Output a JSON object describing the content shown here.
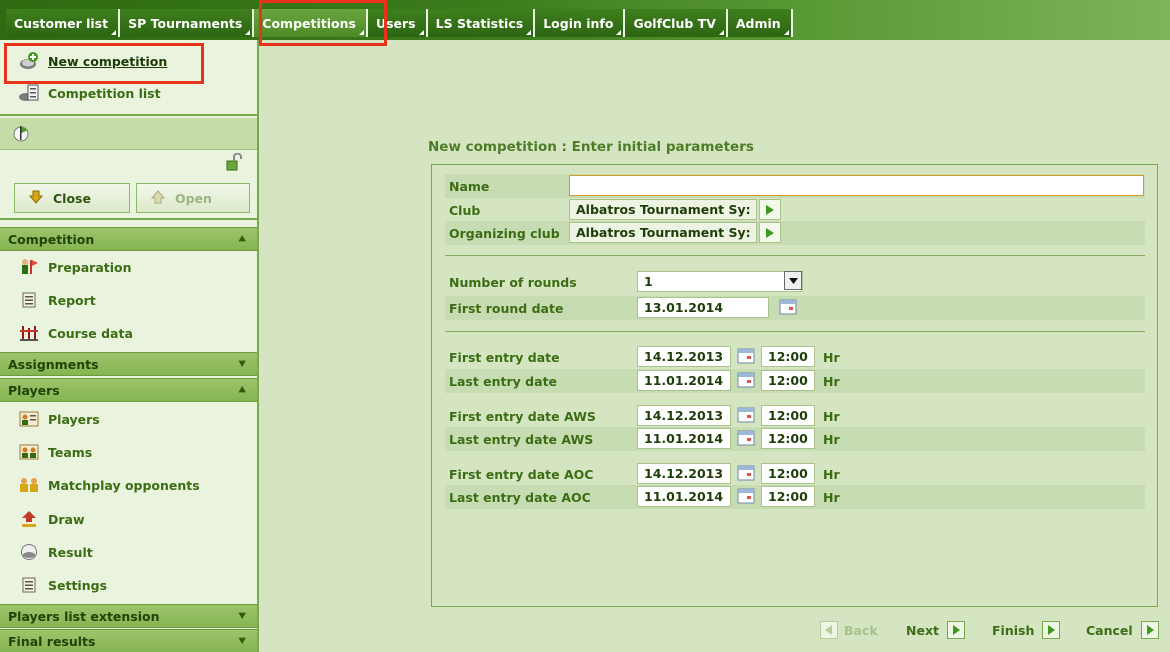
{
  "topnav": {
    "items": [
      {
        "label": "Customer list"
      },
      {
        "label": "SP Tournaments"
      },
      {
        "label": "Competitions"
      },
      {
        "label": "Users"
      },
      {
        "label": "LS Statistics"
      },
      {
        "label": "Login info"
      },
      {
        "label": "GolfClub TV"
      },
      {
        "label": "Admin"
      }
    ]
  },
  "sidebar": {
    "new_competition": "New competition",
    "competition_list": "Competition list",
    "close_button": "Close",
    "open_button": "Open",
    "sections": {
      "competition": "Competition",
      "assignments": "Assignments",
      "players": "Players",
      "players_list_extension": "Players list extension",
      "final_results": "Final results"
    },
    "competition_items": [
      "Preparation",
      "Report",
      "Course data"
    ],
    "players_items": [
      "Players",
      "Teams",
      "Matchplay opponents",
      "Draw",
      "Result",
      "Settings"
    ]
  },
  "form": {
    "title": "New competition : Enter initial parameters",
    "name_label": "Name",
    "name_value": "",
    "club_label": "Club",
    "club_value": "Albatros Tournament Sy:",
    "org_club_label": "Organizing club",
    "org_club_value": "Albatros Tournament Sy:",
    "rounds_label": "Number of rounds",
    "rounds_value": "1",
    "first_round_label": "First round date",
    "first_round_value": "13.01.2014",
    "hr_unit": "Hr",
    "entry_rows": [
      {
        "label": "First entry date",
        "date": "14.12.2013",
        "time": "12:00"
      },
      {
        "label": "Last entry date",
        "date": "11.01.2014",
        "time": "12:00"
      },
      {
        "label": "First entry date AWS",
        "date": "14.12.2013",
        "time": "12:00"
      },
      {
        "label": "Last entry date AWS",
        "date": "11.01.2014",
        "time": "12:00"
      },
      {
        "label": "First entry date AOC",
        "date": "14.12.2013",
        "time": "12:00"
      },
      {
        "label": "Last entry date AOC",
        "date": "11.01.2014",
        "time": "12:00"
      }
    ]
  },
  "wizard": {
    "back": "Back",
    "next": "Next",
    "finish": "Finish",
    "cancel": "Cancel"
  }
}
